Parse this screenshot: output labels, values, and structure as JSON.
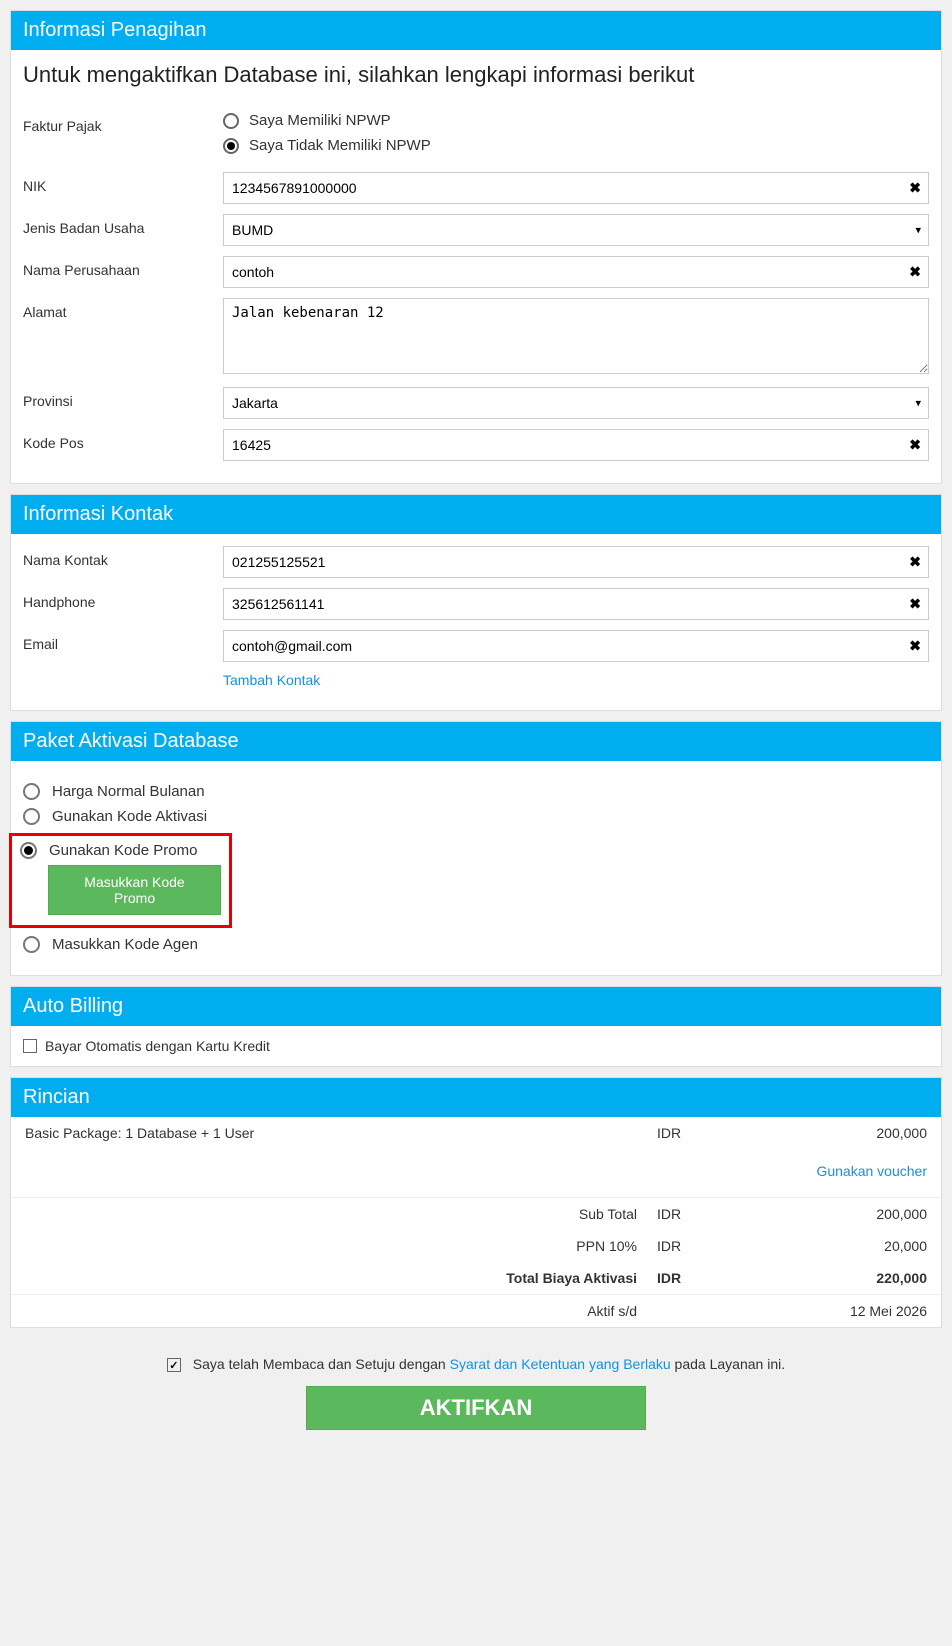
{
  "billing": {
    "header": "Informasi Penagihan",
    "lead": "Untuk mengaktifkan Database ini, silahkan lengkapi informasi berikut",
    "faktur_label": "Faktur Pajak",
    "radio_have": "Saya Memiliki NPWP",
    "radio_nohave": "Saya Tidak Memiliki NPWP",
    "nik_label": "NIK",
    "nik_value": "1234567891000000",
    "jenis_label": "Jenis Badan Usaha",
    "jenis_value": "BUMD",
    "nama_label": "Nama Perusahaan",
    "nama_value": "contoh",
    "alamat_label": "Alamat",
    "alamat_value": "Jalan kebenaran 12",
    "provinsi_label": "Provinsi",
    "provinsi_value": "Jakarta",
    "kodepos_label": "Kode Pos",
    "kodepos_value": "16425"
  },
  "contact": {
    "header": "Informasi Kontak",
    "nama_label": "Nama Kontak",
    "nama_value": "021255125521",
    "hp_label": "Handphone",
    "hp_value": "325612561141",
    "email_label": "Email",
    "email_value": "contoh@gmail.com",
    "add_link": "Tambah Kontak"
  },
  "package": {
    "header": "Paket Aktivasi Database",
    "opt_normal": "Harga Normal Bulanan",
    "opt_aktivasi": "Gunakan Kode Aktivasi",
    "opt_promo": "Gunakan Kode Promo",
    "btn_promo": "Masukkan Kode Promo",
    "opt_agen": "Masukkan Kode Agen"
  },
  "autobilling": {
    "header": "Auto Billing",
    "checkbox_label": "Bayar Otomatis dengan Kartu Kredit"
  },
  "rincian": {
    "header": "Rincian",
    "item_label": "Basic Package: 1 Database + 1 User",
    "item_cur": "IDR",
    "item_val": "200,000",
    "voucher_link": "Gunakan voucher",
    "subtotal_label": "Sub Total",
    "subtotal_cur": "IDR",
    "subtotal_val": "200,000",
    "ppn_label": "PPN 10%",
    "ppn_cur": "IDR",
    "ppn_val": "20,000",
    "total_label": "Total Biaya Aktivasi",
    "total_cur": "IDR",
    "total_val": "220,000",
    "aktif_label": "Aktif s/d",
    "aktif_val": "12 Mei 2026"
  },
  "confirm": {
    "pre": "Saya telah Membaca dan Setuju dengan ",
    "link": "Syarat dan Ketentuan yang Berlaku",
    "post": " pada Layanan ini."
  },
  "main_button": "AKTIFKAN"
}
